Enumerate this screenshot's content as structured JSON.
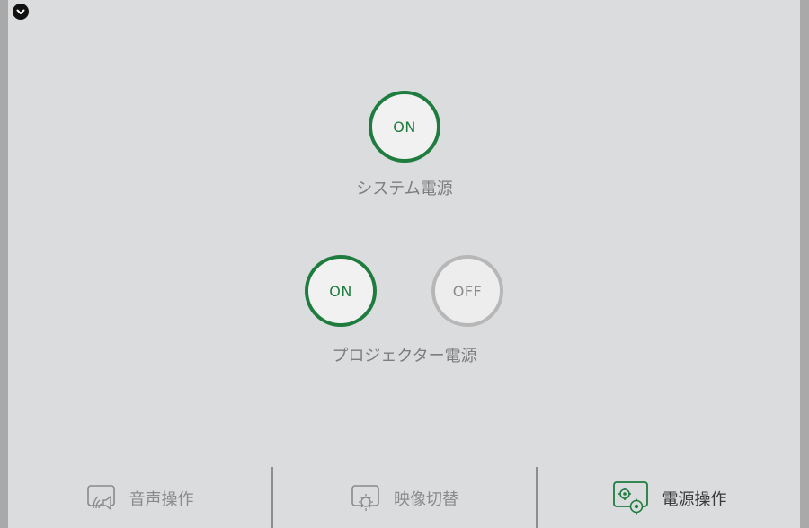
{
  "system_power": {
    "label": "システム電源",
    "on_label": "ON"
  },
  "projector_power": {
    "label": "プロジェクター電源",
    "on_label": "ON",
    "off_label": "OFF"
  },
  "nav": {
    "audio": "音声操作",
    "video": "映像切替",
    "power": "電源操作",
    "active_tab": "power"
  },
  "colors": {
    "accent": "#1f7c3f",
    "background": "#dbdcde",
    "off_ring": "#b7b7b7"
  },
  "icons": [
    "chevron-down-icon",
    "audio-icon",
    "video-source-icon",
    "power-settings-icon"
  ]
}
